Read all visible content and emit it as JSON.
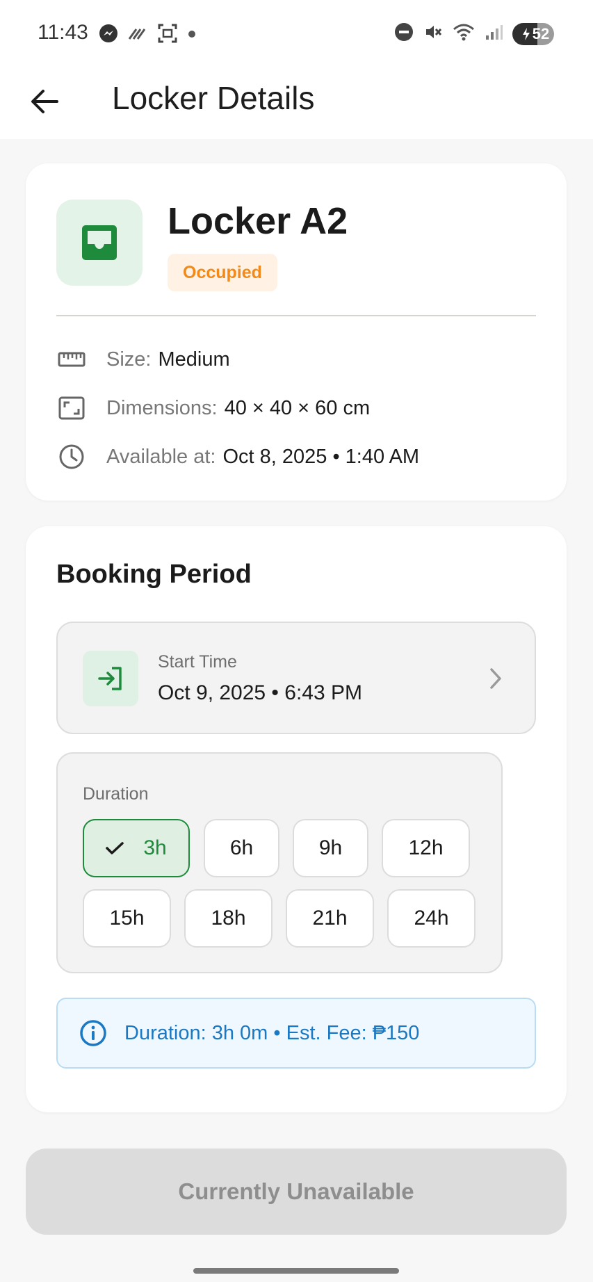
{
  "status_bar": {
    "time": "11:43",
    "battery": "52",
    "left_icons": [
      "messenger-icon",
      "signal-lines-icon",
      "screenshot-icon",
      "dot-icon"
    ],
    "right_icons": [
      "dnd-icon",
      "mute-icon",
      "wifi-icon",
      "signal-icon",
      "battery-icon"
    ]
  },
  "app_bar": {
    "title": "Locker Details",
    "back_icon": "arrow-left-icon"
  },
  "locker": {
    "name": "Locker A2",
    "status": "Occupied",
    "icon": "inbox-tray-icon",
    "details": [
      {
        "icon": "ruler-icon",
        "label": "Size:",
        "value": "Medium"
      },
      {
        "icon": "dimensions-icon",
        "label": "Dimensions:",
        "value": "40 × 40 × 60 cm"
      },
      {
        "icon": "clock-icon",
        "label": "Available at:",
        "value": "Oct 8, 2025 • 1:40 AM"
      }
    ]
  },
  "booking": {
    "section_title": "Booking Period",
    "start": {
      "label": "Start Time",
      "value": "Oct 9, 2025 • 6:43 PM",
      "icon": "login-arrow-icon"
    },
    "duration": {
      "label": "Duration",
      "options": [
        "3h",
        "6h",
        "9h",
        "12h",
        "15h",
        "18h",
        "21h",
        "24h"
      ],
      "selected": "3h"
    },
    "fee_info": "Duration: 3h 0m • Est. Fee: ₱150"
  },
  "cta": {
    "label": "Currently Unavailable"
  },
  "colors": {
    "accent_green": "#1e8a3c",
    "status_orange": "#f28a1a",
    "info_blue": "#1b78c2",
    "disabled_gray": "#dcdcdc"
  }
}
